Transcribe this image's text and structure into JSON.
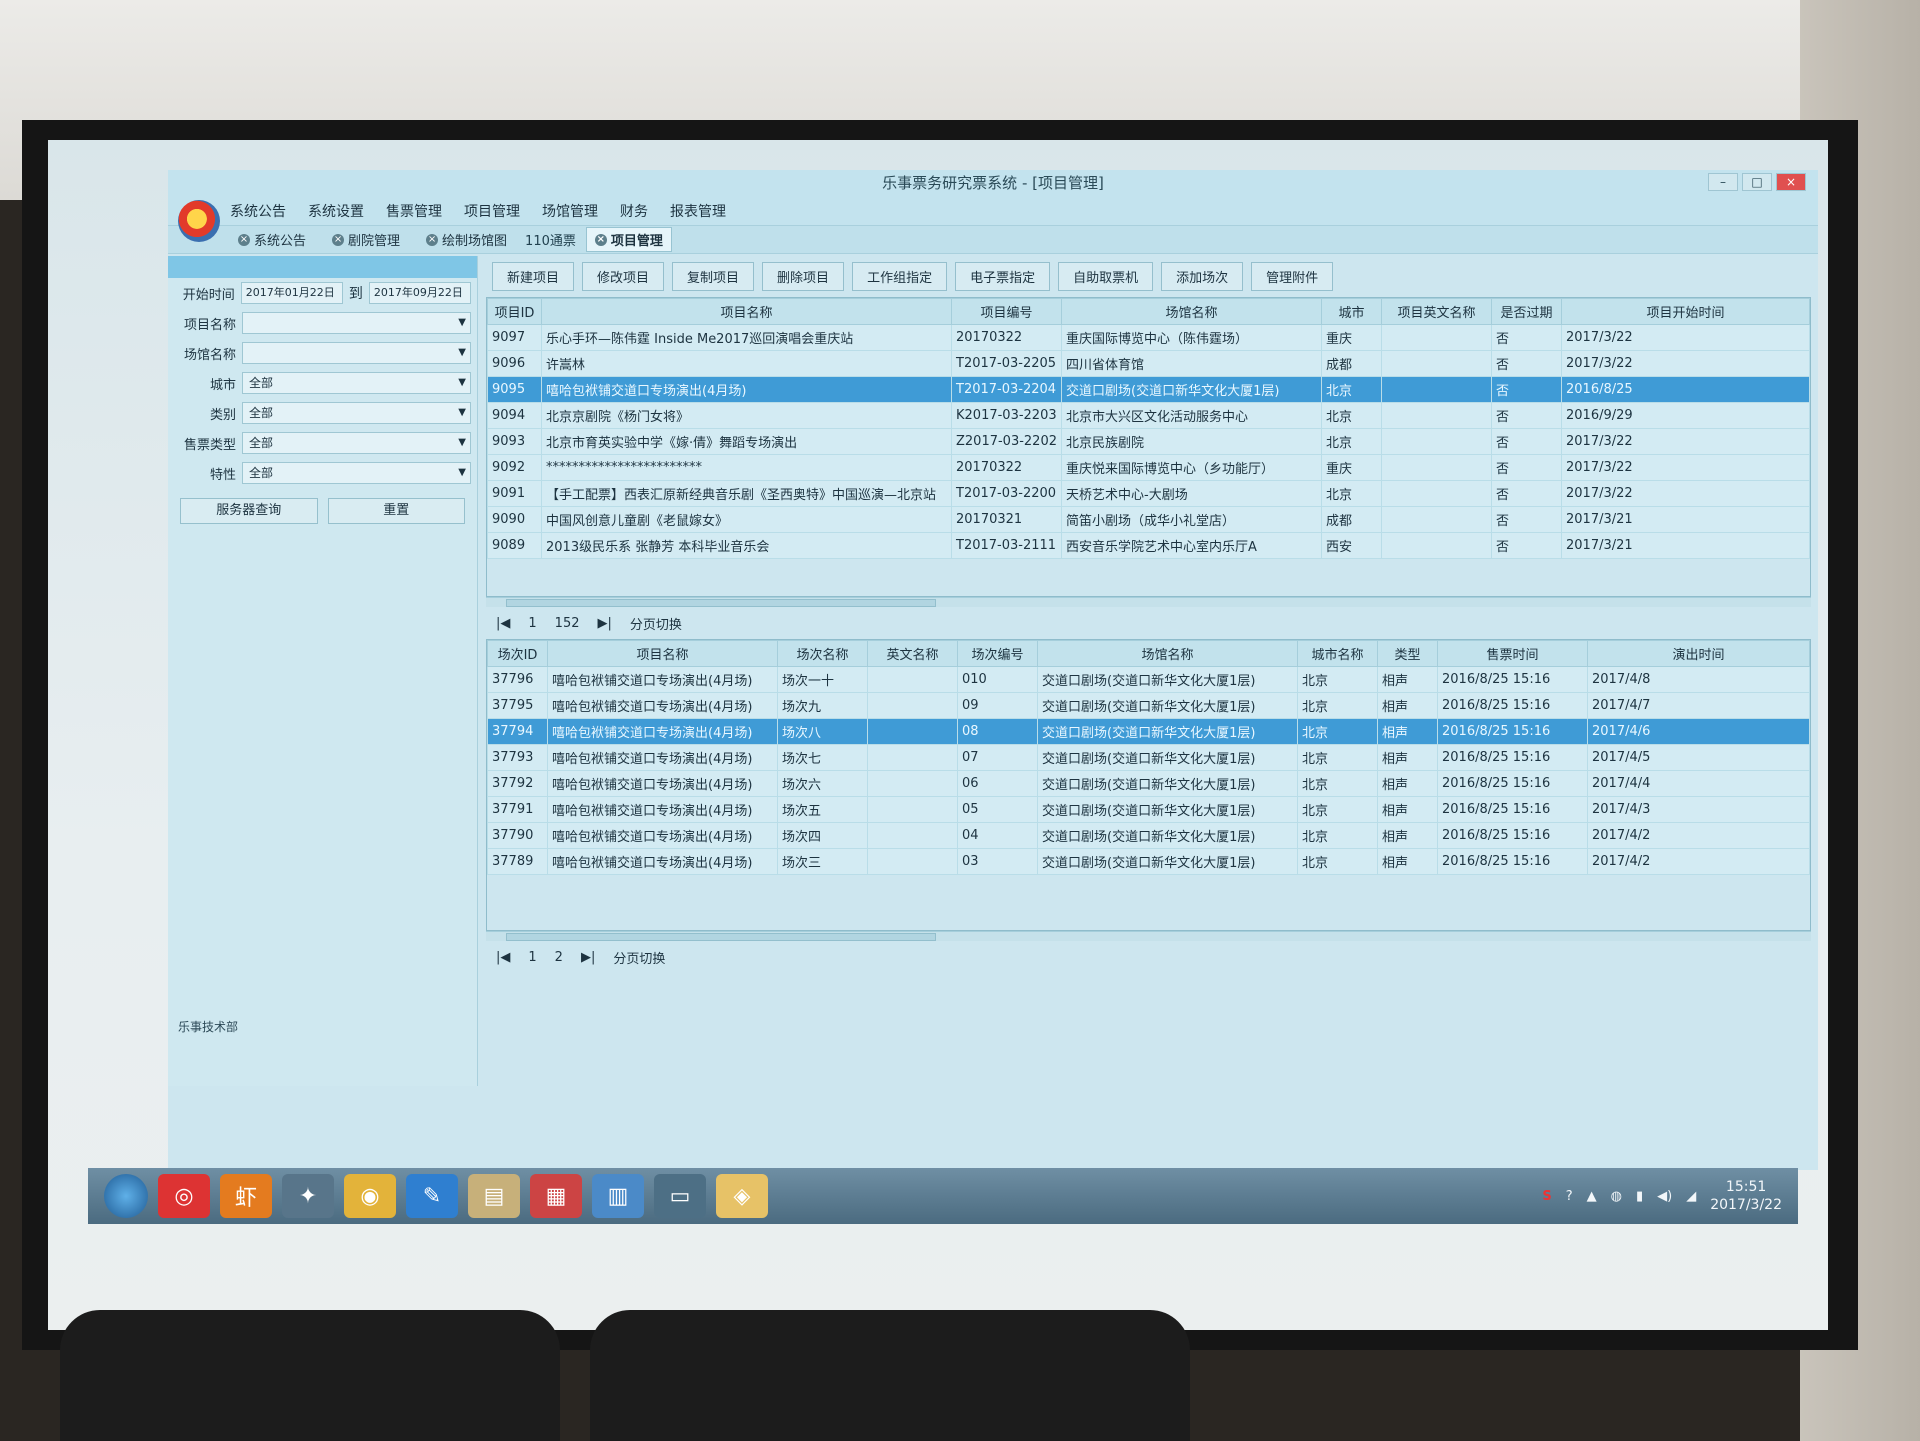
{
  "window": {
    "title": "乐事票务研究票系统 - [项目管理]",
    "controls": [
      "–",
      "□",
      "×"
    ]
  },
  "menu": [
    "系统公告",
    "系统设置",
    "售票管理",
    "项目管理",
    "场馆管理",
    "财务",
    "报表管理"
  ],
  "tabs": [
    {
      "label": "系统公告",
      "active": false
    },
    {
      "label": "剧院管理",
      "active": false
    },
    {
      "label": "绘制场馆图",
      "active": false
    },
    {
      "label": "项目管理",
      "active": true
    }
  ],
  "recent": "110通票",
  "filters": {
    "start_label": "开始时间",
    "start_value": "2017年01月22日",
    "to": "到",
    "end_value": "2017年09月22日",
    "fields": [
      {
        "label": "项目名称",
        "value": ""
      },
      {
        "label": "场馆名称",
        "value": ""
      },
      {
        "label": "城市",
        "value": "全部"
      },
      {
        "label": "类别",
        "value": "全部"
      },
      {
        "label": "售票类型",
        "value": "全部"
      },
      {
        "label": "特性",
        "value": "全部"
      }
    ],
    "btn_query": "服务器查询",
    "btn_reset": "重置"
  },
  "toolbar": [
    "新建项目",
    "修改项目",
    "复制项目",
    "删除项目",
    "工作组指定",
    "电子票指定",
    "自助取票机",
    "添加场次",
    "管理附件"
  ],
  "projects": {
    "headers": [
      "项目ID",
      "项目名称",
      "项目编号",
      "场馆名称",
      "城市",
      "项目英文名称",
      "是否过期",
      "项目开始时间"
    ],
    "rows": [
      {
        "id": "9097",
        "name": "乐心手环—陈伟霆 Inside Me2017巡回演唱会重庆站",
        "code": "20170322",
        "venue": "重庆国际博览中心（陈伟霆场）",
        "city": "重庆",
        "en": "",
        "expired": "否",
        "start": "2017/3/22"
      },
      {
        "id": "9096",
        "name": "许嵩林",
        "code": "T2017-03-2205",
        "venue": "四川省体育馆",
        "city": "成都",
        "en": "",
        "expired": "否",
        "start": "2017/3/22"
      },
      {
        "id": "9095",
        "name": "嘻哈包袱铺交道口专场演出(4月场)",
        "code": "T2017-03-2204",
        "venue": "交道口剧场(交道口新华文化大厦1层)",
        "city": "北京",
        "en": "",
        "expired": "否",
        "start": "2016/8/25"
      },
      {
        "id": "9094",
        "name": "北京京剧院《杨门女将》",
        "code": "K2017-03-2203",
        "venue": "北京市大兴区文化活动服务中心",
        "city": "北京",
        "en": "",
        "expired": "否",
        "start": "2016/9/29"
      },
      {
        "id": "9093",
        "name": "北京市育英实验中学《嫁·倩》舞蹈专场演出",
        "code": "Z2017-03-2202",
        "venue": "北京民族剧院",
        "city": "北京",
        "en": "",
        "expired": "否",
        "start": "2017/3/22"
      },
      {
        "id": "9092",
        "name": "************************",
        "code": "20170322",
        "venue": "重庆悦来国际博览中心（乡功能厅）",
        "city": "重庆",
        "en": "",
        "expired": "否",
        "start": "2017/3/22"
      },
      {
        "id": "9091",
        "name": "【手工配票】西表汇原新经典音乐剧《圣西奥特》中国巡演—北京站",
        "code": "T2017-03-2200",
        "venue": "天桥艺术中心-大剧场",
        "city": "北京",
        "en": "",
        "expired": "否",
        "start": "2017/3/22"
      },
      {
        "id": "9090",
        "name": "中国风创意儿童剧《老鼠嫁女》",
        "code": "20170321",
        "venue": "简笛小剧场（成华小礼堂店）",
        "city": "成都",
        "en": "",
        "expired": "否",
        "start": "2017/3/21"
      },
      {
        "id": "9089",
        "name": "2013级民乐系 张静芳 本科毕业音乐会",
        "code": "T2017-03-2111",
        "venue": "西安音乐学院艺术中心室内乐厅A",
        "city": "西安",
        "en": "",
        "expired": "否",
        "start": "2017/3/21"
      }
    ]
  },
  "pager1": {
    "first": "|◀",
    "page": "1",
    "total": "152",
    "last": "▶|",
    "label": "分页切换"
  },
  "sessions": {
    "headers": [
      "场次ID",
      "项目名称",
      "场次名称",
      "英文名称",
      "场次编号",
      "场馆名称",
      "城市名称",
      "类型",
      "售票时间",
      "演出时间"
    ],
    "rows": [
      {
        "id": "37796",
        "proj": "嘻哈包袱铺交道口专场演出(4月场)",
        "name": "场次一十",
        "en": "",
        "no": "010",
        "venue": "交道口剧场(交道口新华文化大厦1层)",
        "city": "北京",
        "type": "相声",
        "sale": "2016/8/25 15:16",
        "show": "2017/4/8"
      },
      {
        "id": "37795",
        "proj": "嘻哈包袱铺交道口专场演出(4月场)",
        "name": "场次九",
        "en": "",
        "no": "09",
        "venue": "交道口剧场(交道口新华文化大厦1层)",
        "city": "北京",
        "type": "相声",
        "sale": "2016/8/25 15:16",
        "show": "2017/4/7"
      },
      {
        "id": "37794",
        "proj": "嘻哈包袱铺交道口专场演出(4月场)",
        "name": "场次八",
        "en": "",
        "no": "08",
        "venue": "交道口剧场(交道口新华文化大厦1层)",
        "city": "北京",
        "type": "相声",
        "sale": "2016/8/25 15:16",
        "show": "2017/4/6"
      },
      {
        "id": "37793",
        "proj": "嘻哈包袱铺交道口专场演出(4月场)",
        "name": "场次七",
        "en": "",
        "no": "07",
        "venue": "交道口剧场(交道口新华文化大厦1层)",
        "city": "北京",
        "type": "相声",
        "sale": "2016/8/25 15:16",
        "show": "2017/4/5"
      },
      {
        "id": "37792",
        "proj": "嘻哈包袱铺交道口专场演出(4月场)",
        "name": "场次六",
        "en": "",
        "no": "06",
        "venue": "交道口剧场(交道口新华文化大厦1层)",
        "city": "北京",
        "type": "相声",
        "sale": "2016/8/25 15:16",
        "show": "2017/4/4"
      },
      {
        "id": "37791",
        "proj": "嘻哈包袱铺交道口专场演出(4月场)",
        "name": "场次五",
        "en": "",
        "no": "05",
        "venue": "交道口剧场(交道口新华文化大厦1层)",
        "city": "北京",
        "type": "相声",
        "sale": "2016/8/25 15:16",
        "show": "2017/4/3"
      },
      {
        "id": "37790",
        "proj": "嘻哈包袱铺交道口专场演出(4月场)",
        "name": "场次四",
        "en": "",
        "no": "04",
        "venue": "交道口剧场(交道口新华文化大厦1层)",
        "city": "北京",
        "type": "相声",
        "sale": "2016/8/25 15:16",
        "show": "2017/4/2"
      },
      {
        "id": "37789",
        "proj": "嘻哈包袱铺交道口专场演出(4月场)",
        "name": "场次三",
        "en": "",
        "no": "03",
        "venue": "交道口剧场(交道口新华文化大厦1层)",
        "city": "北京",
        "type": "相声",
        "sale": "2016/8/25 15:16",
        "show": "2017/4/2"
      }
    ]
  },
  "pager2": {
    "first": "|◀",
    "page": "1",
    "total": "2",
    "last": "▶|",
    "label": "分页切换"
  },
  "status_text": "乐事技术部",
  "clock": {
    "time": "15:51",
    "date": "2017/3/22"
  }
}
